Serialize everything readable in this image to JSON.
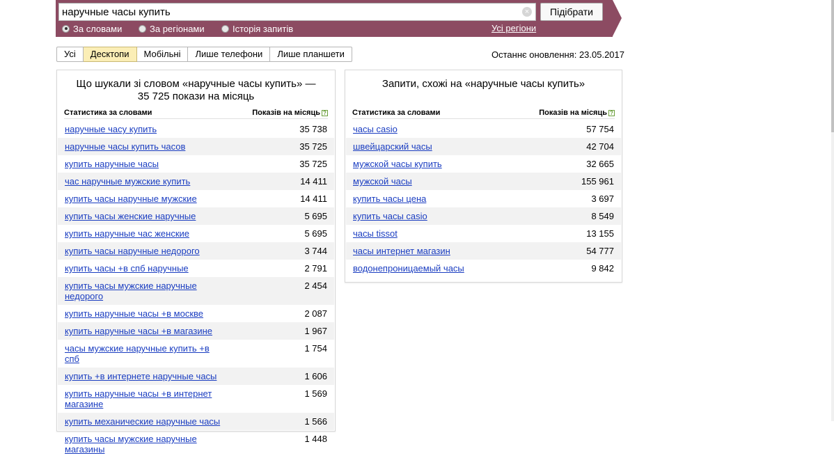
{
  "search": {
    "query": "наручные часы купить",
    "clear_icon": "×",
    "button_label": "Підібрати"
  },
  "modes": [
    {
      "label": "За словами",
      "checked": true
    },
    {
      "label": "За регіонами",
      "checked": false
    },
    {
      "label": "Історія запитів",
      "checked": false
    }
  ],
  "regions_link": "Усі регіони",
  "device_tabs": [
    {
      "label": "Усі",
      "active": false
    },
    {
      "label": "Десктопи",
      "active": true
    },
    {
      "label": "Мобільні",
      "active": false
    },
    {
      "label": "Лише телефони",
      "active": false
    },
    {
      "label": "Лише планшети",
      "active": false
    }
  ],
  "last_update": "Останнє оновлення: 23.05.2017",
  "left_panel": {
    "title": "Що шукали зі словом «наручные часы купить» — 35 725 покази на місяць",
    "col_words": "Статистика за словами",
    "col_count": "Показів на місяць",
    "help_icon": "?",
    "rows": [
      {
        "query": "наручные часу купить",
        "count": "35 738"
      },
      {
        "query": "наручные часы купить часов",
        "count": "35 725"
      },
      {
        "query": "купить наручные часы",
        "count": "35 725"
      },
      {
        "query": "час наручные мужские купить",
        "count": "14 411"
      },
      {
        "query": "купить часы наручные мужские",
        "count": "14 411"
      },
      {
        "query": "купить часы женские наручные",
        "count": "5 695"
      },
      {
        "query": "купить наручные час женские",
        "count": "5 695"
      },
      {
        "query": "купить часы наручные недорого",
        "count": "3 744"
      },
      {
        "query": "купить часы +в спб наручные",
        "count": "2 791"
      },
      {
        "query": "купить часы мужские наручные недорого",
        "count": "2 454"
      },
      {
        "query": "купить наручные часы +в москве",
        "count": "2 087"
      },
      {
        "query": "купить наручные часы +в магазине",
        "count": "1 967"
      },
      {
        "query": "часы мужские наручные купить +в спб",
        "count": "1 754"
      },
      {
        "query": "купить +в интернете наручные часы",
        "count": "1 606"
      },
      {
        "query": "купить наручные часы +в интернет магазине",
        "count": "1 569"
      },
      {
        "query": "купить механические наручные часы",
        "count": "1 566"
      },
      {
        "query": "купить часы мужские наручные магазины",
        "count": "1 448"
      }
    ]
  },
  "right_panel": {
    "title": "Запити, схожі на «наручные часы купить»",
    "col_words": "Статистика за словами",
    "col_count": "Показів на місяць",
    "help_icon": "?",
    "rows": [
      {
        "query": "часы casio",
        "count": "57 754"
      },
      {
        "query": "швейцарский часы",
        "count": "42 704"
      },
      {
        "query": "мужской часы купить",
        "count": "32 665"
      },
      {
        "query": "мужской часы",
        "count": "155 961"
      },
      {
        "query": "купить часы цена",
        "count": "3 697"
      },
      {
        "query": "купить часы casio",
        "count": "8 549"
      },
      {
        "query": "часы tissot",
        "count": "13 155"
      },
      {
        "query": "часы интернет магазин",
        "count": "54 777"
      },
      {
        "query": "водонепроницаемый часы",
        "count": "9 842"
      }
    ]
  }
}
